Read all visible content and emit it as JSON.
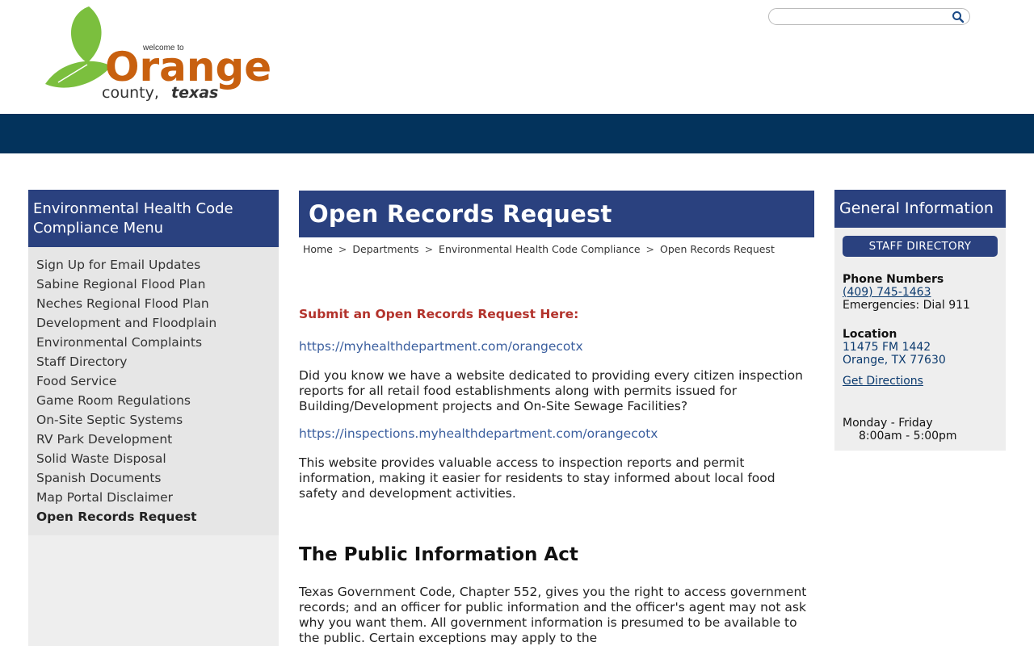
{
  "header": {
    "logo": {
      "welcome": "welcome to",
      "name": "Orange",
      "sub1": "county,",
      "sub2": "texas"
    },
    "search": {
      "placeholder": "",
      "value": ""
    }
  },
  "left_menu": {
    "title": "Environmental Health Code Compliance Menu",
    "items": [
      "Sign Up for Email Updates",
      "Sabine Regional Flood Plan",
      "Neches Regional Flood Plan",
      "Development and Floodplain",
      "Environmental Complaints",
      "Staff Directory",
      "Food Service",
      "Game Room Regulations",
      "On-Site Septic Systems",
      "RV Park Development",
      "Solid Waste Disposal",
      "Spanish Documents",
      "Map Portal Disclaimer",
      "Open Records Request"
    ],
    "active_index": 13
  },
  "main": {
    "title": "Open Records Request",
    "breadcrumb": [
      "Home",
      "Departments",
      "Environmental Health Code Compliance",
      "Open Records Request"
    ],
    "breadcrumb_sep": ">",
    "submit_heading": "Submit an Open Records Request Here:",
    "link1": "https://myhealthdepartment.com/orangecotx",
    "para1": "Did you know we have a website dedicated to providing every citizen inspection reports for all retail food establishments along with permits issued for Building/Development projects and On-Site Sewage Facilities?",
    "link2": "https://inspections.myhealthdepartment.com/orangecotx",
    "para2": "This website provides valuable access to inspection reports and permit information, making it easier for residents to stay informed about local food safety and development activities.",
    "pia_heading": "The Public Information Act",
    "para3": "Texas Government Code, Chapter 552, gives you the right to access government records; and an officer for public information and the officer's agent may not ask why you want them. All government information is presumed to be available to the public. Certain exceptions may apply to the"
  },
  "right_box": {
    "title": "General Information",
    "staff_button": "STAFF DIRECTORY",
    "phone_label": "Phone Numbers",
    "phone": "(409) 745-1463",
    "emergencies": "Emergencies: Dial 911",
    "location_label": "Location",
    "address1": "11475 FM 1442",
    "address2": "Orange, TX 77630",
    "directions": "Get Directions",
    "hours_days": "Monday - Friday",
    "hours_time": "8:00am - 5:00pm"
  },
  "colors": {
    "nav": "#03335c",
    "panel_header": "#2a417f",
    "accent_red": "#b3332c",
    "link_blue": "#3a5e9e",
    "logo_orange": "#c8600f",
    "logo_green": "#7bbf3e"
  }
}
